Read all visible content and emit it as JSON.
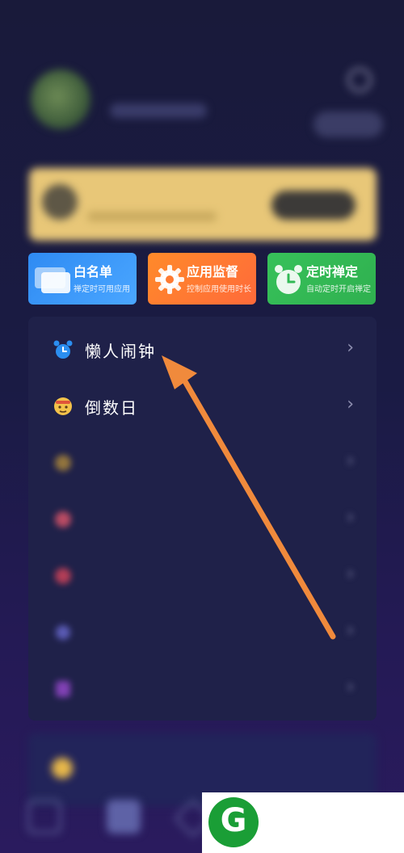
{
  "status_bar": {
    "time": "",
    "right": ""
  },
  "profile": {
    "username": "",
    "badge_label": ""
  },
  "vip_banner": {
    "title": "",
    "button": ""
  },
  "feature_cards": [
    {
      "title": "白名单",
      "subtitle": "禅定时可用应用",
      "icon": "window-icon",
      "color": "#2f8bf3"
    },
    {
      "title": "应用监督",
      "subtitle": "控制应用使用时长",
      "icon": "gear-icon",
      "color": "#ff7a30"
    },
    {
      "title": "定时禅定",
      "subtitle": "自动定时开启禅定",
      "icon": "alarm-clock-icon",
      "color": "#33b955"
    }
  ],
  "menu": {
    "items": [
      {
        "label": "懒人闹钟",
        "icon": "alarm-clock-icon",
        "icon_color": "#3aa0ff"
      },
      {
        "label": "倒数日",
        "icon": "emoji-face-icon",
        "icon_color": "#f3c24a"
      },
      {
        "label": "",
        "icon": "blurred-icon",
        "icon_color": "#b08a3a"
      },
      {
        "label": "",
        "icon": "blurred-icon",
        "icon_color": "#e0566a"
      },
      {
        "label": "",
        "icon": "blurred-icon",
        "icon_color": "#d8455a"
      },
      {
        "label": "",
        "icon": "blurred-icon",
        "icon_color": "#6a6ad0"
      },
      {
        "label": "",
        "icon": "blurred-icon",
        "icon_color": "#9a4ad0"
      }
    ],
    "chevron": "›"
  },
  "bottom_item": {
    "label": "",
    "icon_color": "#e8b84a"
  },
  "logo": {
    "letter": "G",
    "color": "#1a9e36"
  },
  "annotation_arrow": {
    "color": "#f08a3c"
  }
}
